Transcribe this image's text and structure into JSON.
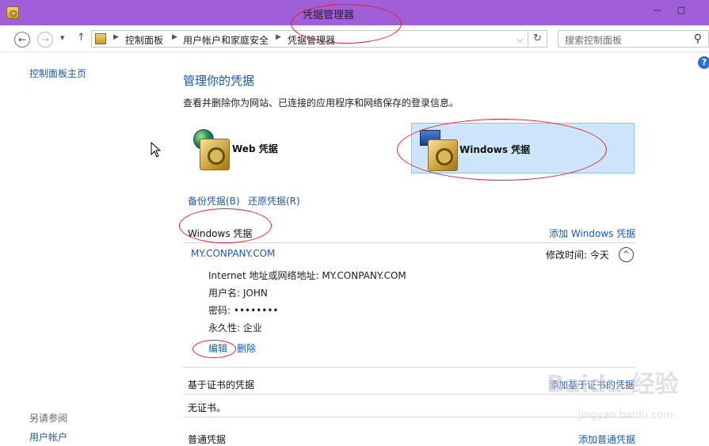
{
  "window": {
    "title": "凭据管理器",
    "min": "—",
    "max": "□"
  },
  "nav": {
    "back": "←",
    "forward": "→",
    "dropdown": "▾",
    "up": "↑",
    "refresh": "↻"
  },
  "breadcrumb": [
    "控制面板",
    "用户帐户和家庭安全",
    "凭据管理器"
  ],
  "search": {
    "placeholder": "搜索控制面板",
    "icon": "search-icon"
  },
  "sidebar": {
    "home": "控制面板主页",
    "see_also": "另请参阅",
    "user_accounts": "用户帐户"
  },
  "main": {
    "title": "管理你的凭据",
    "desc": "查看并删除你为网站、已连接的应用程序和网络保存的登录信息。",
    "tiles": [
      {
        "label": "Web 凭据",
        "icon": "globe-safe-icon"
      },
      {
        "label": "Windows 凭据",
        "icon": "monitor-safe-icon"
      }
    ],
    "backup": "备份凭据(B)",
    "restore": "还原凭据(R)",
    "windows_section": {
      "heading": "Windows 凭据",
      "add": "添加 Windows 凭据",
      "entry": {
        "name": "MY.CONPANY.COM",
        "modified": "修改时间: 今天",
        "address_label": "Internet 地址或网络地址:",
        "address_value": "MY.CONPANY.COM",
        "user_label": "用户名:",
        "user_value": "JOHN",
        "password_label": "密码:",
        "password_value": "••••••••",
        "persistence_label": "永久性:",
        "persistence_value": "企业",
        "edit": "编辑",
        "delete": "删除"
      }
    },
    "cert_section": {
      "heading": "基于证书的凭据",
      "add": "添加基于证书的凭据",
      "empty": "无证书。"
    },
    "generic_section": {
      "heading": "普通凭据",
      "add": "添加普通凭据"
    }
  },
  "watermark": {
    "text": "Baidu 经验",
    "sub": "jingyan.baidu.com"
  },
  "colors": {
    "titlebar": "#a05fd6",
    "link": "#1c5aa8",
    "annotation": "#e0242c",
    "selected_tile": "#cde6fb"
  }
}
